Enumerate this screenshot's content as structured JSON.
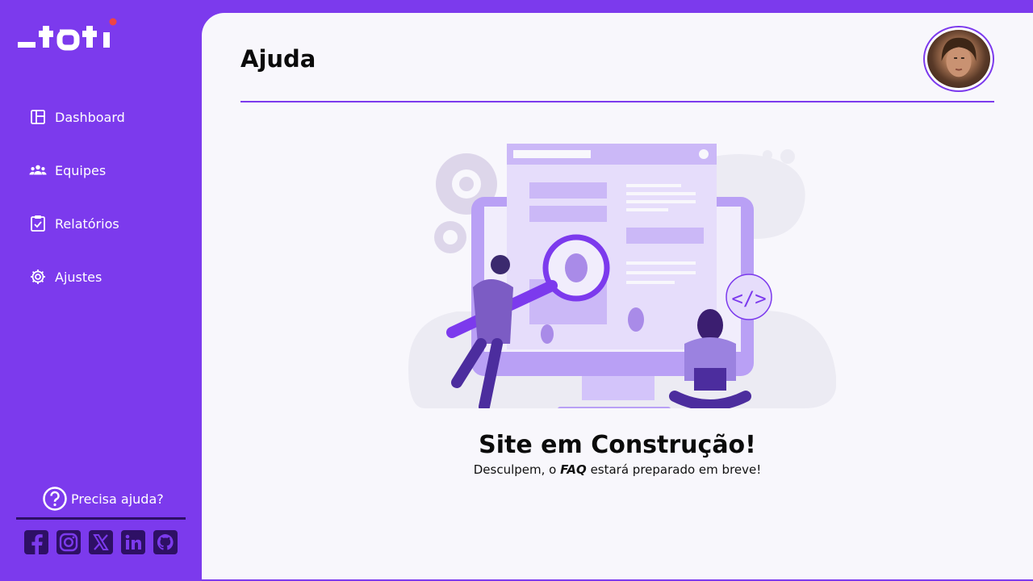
{
  "brand": {
    "logo_text": "_toti",
    "accent": "#7c3aed",
    "dot_color": "#ef4444"
  },
  "sidebar": {
    "items": [
      {
        "label": "Dashboard",
        "icon": "layout-icon"
      },
      {
        "label": "Equipes",
        "icon": "users-icon"
      },
      {
        "label": "Relatórios",
        "icon": "clipboard-check-icon"
      },
      {
        "label": "Ajustes",
        "icon": "gear-icon"
      }
    ],
    "help_label": "Precisa ajuda?",
    "socials": [
      "facebook-icon",
      "instagram-icon",
      "x-icon",
      "linkedin-icon",
      "github-icon"
    ]
  },
  "header": {
    "title": "Ajuda"
  },
  "content": {
    "headline": "Site em Construção!",
    "sub_prefix": "Desculpem, o ",
    "sub_emphasis": "FAQ",
    "sub_suffix": " estará preparado em breve!"
  }
}
